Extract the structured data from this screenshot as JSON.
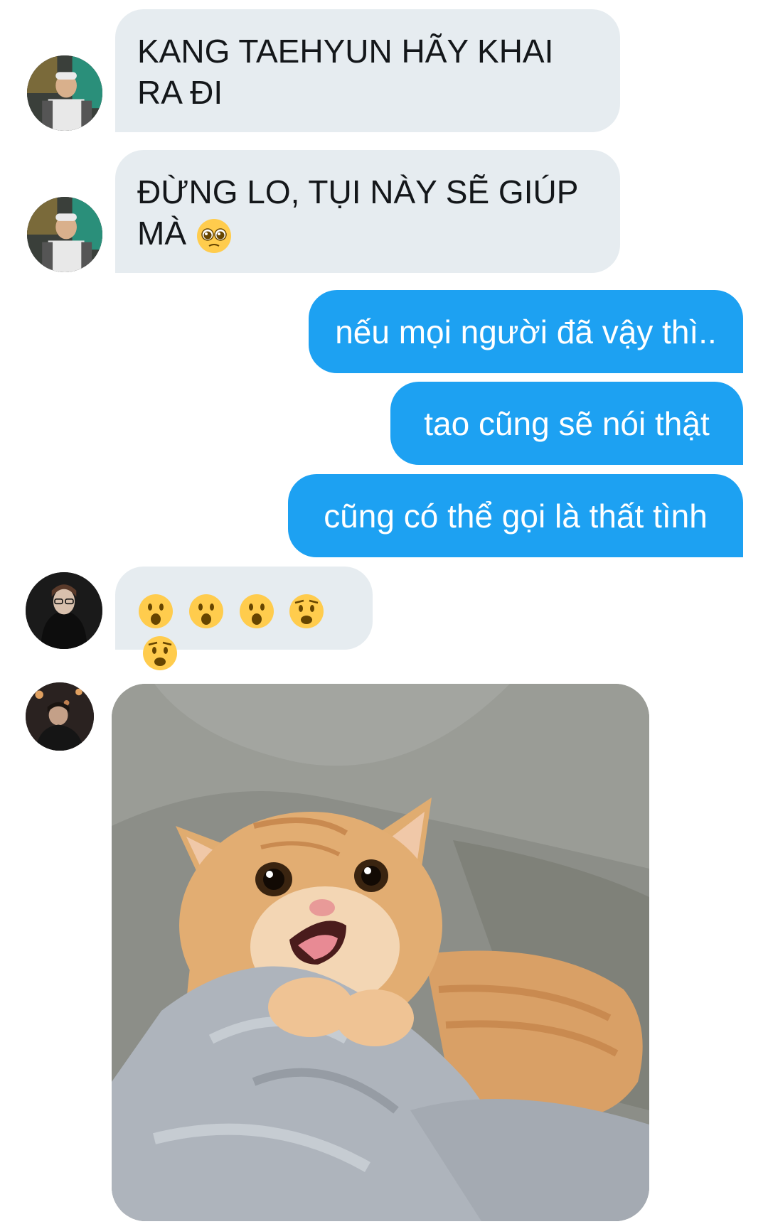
{
  "messages": [
    {
      "direction": "incoming",
      "text": "KANG TAEHYUN HÃY KHAI RA ĐI"
    },
    {
      "direction": "incoming",
      "text": "ĐỪNG LO, TỤI NÀY SẼ GIÚP MÀ",
      "emoji": "pleading-face-emoji"
    },
    {
      "direction": "outgoing",
      "text": "nếu mọi người đã vậy thì.."
    },
    {
      "direction": "outgoing",
      "text": "tao cũng sẽ nói thật"
    },
    {
      "direction": "outgoing",
      "text": "cũng có thể gọi là thất tình"
    },
    {
      "direction": "incoming",
      "emojis": [
        "hushed-face-emoji",
        "hushed-face-emoji",
        "hushed-face-emoji",
        "worried-face-emoji",
        "worried-face-emoji"
      ]
    },
    {
      "direction": "incoming",
      "media": "surprised-orange-cat-gif"
    }
  ],
  "colors": {
    "incoming_bubble": "#e6ecf0",
    "outgoing_bubble": "#1da1f2",
    "incoming_text": "#14171a",
    "outgoing_text": "#ffffff"
  }
}
